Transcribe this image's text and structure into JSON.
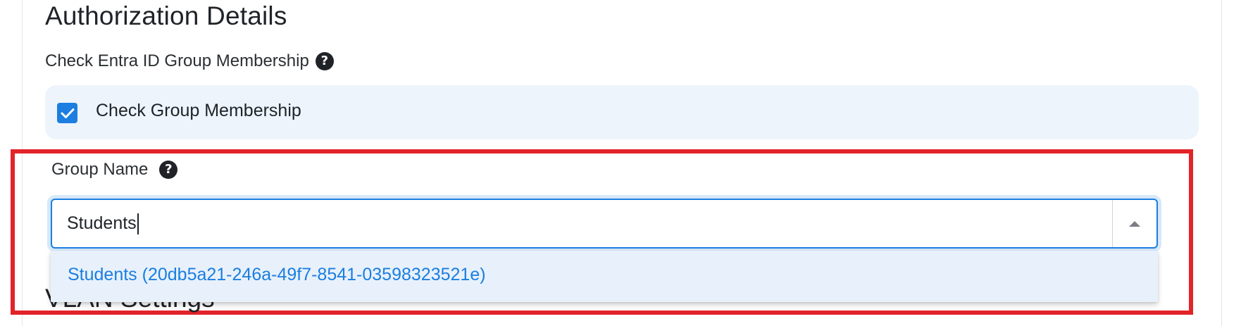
{
  "authorization": {
    "title": "Authorization Details",
    "check_membership_label": "Check Entra ID Group Membership",
    "checkbox_label": "Check Group Membership",
    "checkbox_checked": true
  },
  "group_name": {
    "label": "Group Name",
    "input_value": "Students",
    "dropdown_options": [
      "Students (20db5a21-246a-49f7-8541-03598323521e)"
    ]
  },
  "vlan": {
    "title": "VLAN Settings"
  },
  "colors": {
    "accent": "#1b7ee0",
    "highlight": "#e3232a",
    "card_bg": "#edf4fb"
  },
  "icons": {
    "help": "question-circle-icon",
    "check": "checkmark-icon",
    "dropdown": "caret-up-icon"
  }
}
